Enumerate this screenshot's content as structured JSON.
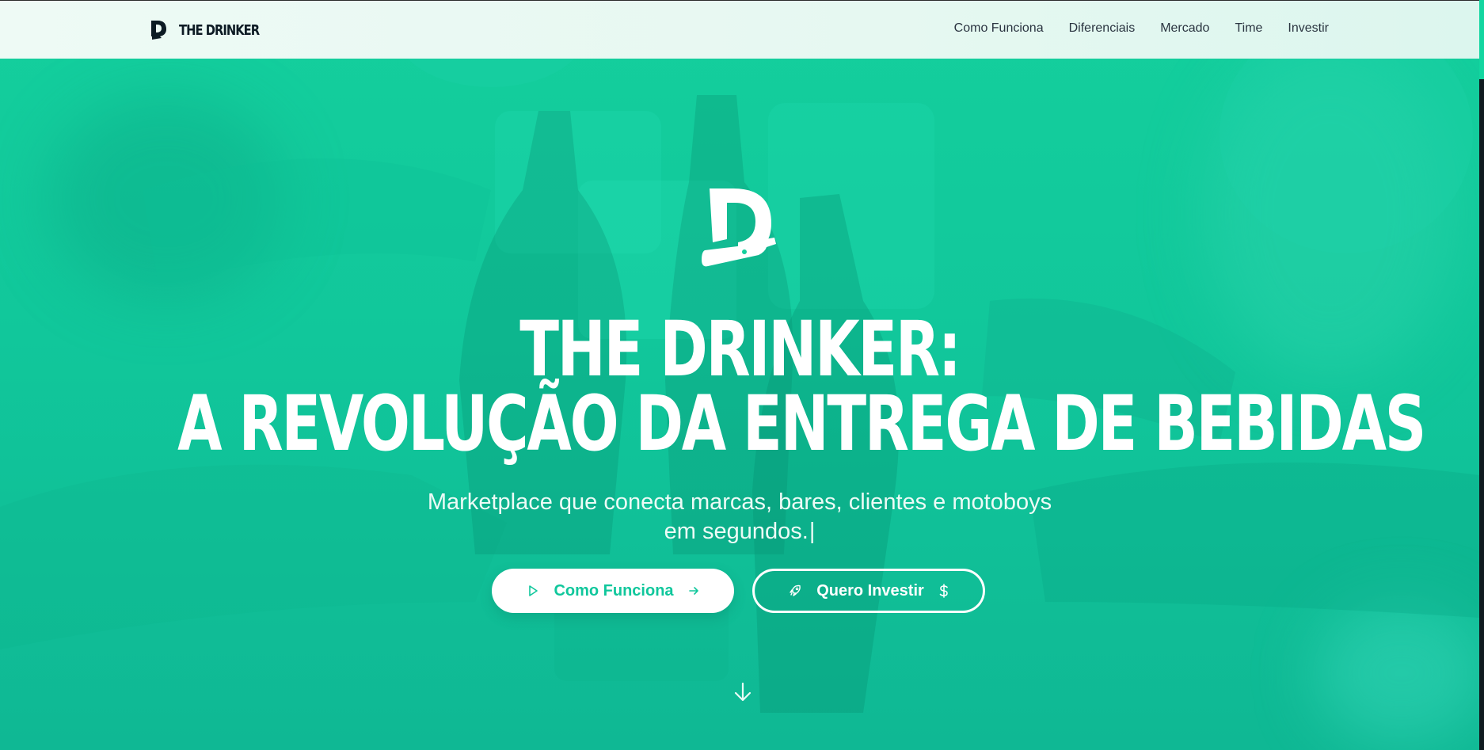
{
  "navbar": {
    "brand": "THE DRINKER",
    "links": [
      "Como Funciona",
      "Diferenciais",
      "Mercado",
      "Time",
      "Investir"
    ]
  },
  "hero": {
    "title_line1": "THE DRINKER:",
    "title_line2": "A REVOLUÇÃO DA ENTREGA DE BEBIDAS",
    "subtitle": "Marketplace que conecta marcas, bares, clientes e motoboys em segundos.",
    "caret": "|",
    "primary_button": {
      "label": "Como Funciona",
      "icon": "play-icon",
      "trailing_icon": "arrow-right-icon"
    },
    "secondary_button": {
      "label": "Quero Investir",
      "icon": "rocket-icon",
      "trailing_icon": "dollar-icon"
    },
    "scroll_icon": "arrow-down-icon"
  },
  "colors": {
    "accent": "#10c79c",
    "hero_bg": "#14cf9d",
    "navbar_bg": "#eefaf5",
    "text_dark": "#0d1b24"
  }
}
